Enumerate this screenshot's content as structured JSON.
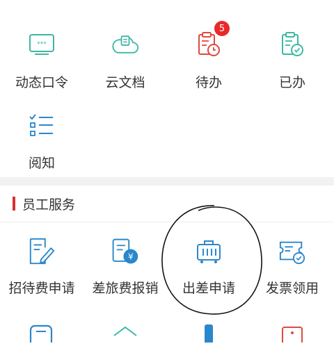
{
  "top_grid": [
    {
      "label": "动态口令",
      "icon": "dynamic-password-icon"
    },
    {
      "label": "云文档",
      "icon": "cloud-document-icon"
    },
    {
      "label": "待办",
      "icon": "todo-clipboard-icon",
      "badge": "5"
    },
    {
      "label": "已办",
      "icon": "done-clipboard-icon"
    },
    {
      "label": "阅知",
      "icon": "read-list-icon"
    }
  ],
  "section": {
    "title": "员工服务"
  },
  "services": [
    {
      "label": "招待费申请",
      "icon": "hospitality-request-icon"
    },
    {
      "label": "差旅费报销",
      "icon": "travel-expense-icon"
    },
    {
      "label": "出差申请",
      "icon": "business-trip-icon"
    },
    {
      "label": "发票领用",
      "icon": "invoice-icon"
    }
  ],
  "colors": {
    "teal": "#3bb8a5",
    "red": "#e0483d",
    "blue": "#2a87cc",
    "badge": "#e82a2a",
    "section_bar": "#d8302f"
  }
}
